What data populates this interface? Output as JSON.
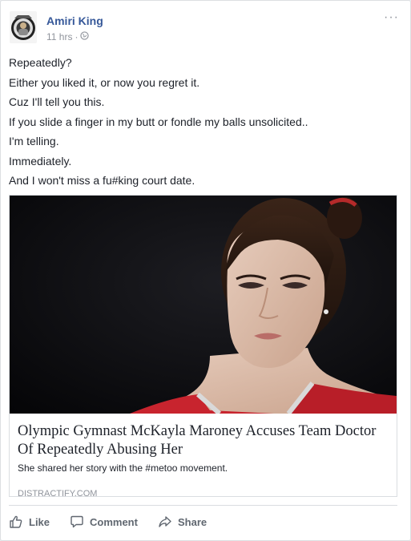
{
  "post": {
    "author": "Amiri King",
    "time": "11 hrs",
    "separator": "·",
    "audience_icon": "globe-icon",
    "more_icon": "ellipsis-icon",
    "more_label": "···",
    "lines": [
      "Repeatedly?",
      "Either you liked it, or now you regret it.",
      "Cuz I'll tell you this.",
      "If you slide a finger in my butt or fondle my balls unsolicited..",
      "I'm telling.",
      "Immediately.",
      "And I won't miss a fu#king court date."
    ]
  },
  "link": {
    "image": "photo of gymnast in red leotard with dark background",
    "title": "Olympic Gymnast McKayla Maroney Accuses Team Doctor Of Repeatedly Abusing Her",
    "description": "She shared her story with the #metoo movement.",
    "domain": "DISTRACTIFY.COM"
  },
  "actions": {
    "like": "Like",
    "comment": "Comment",
    "share": "Share"
  },
  "colors": {
    "author": "#365899",
    "meta": "#90949c",
    "text": "#1d2129",
    "action": "#606770"
  }
}
